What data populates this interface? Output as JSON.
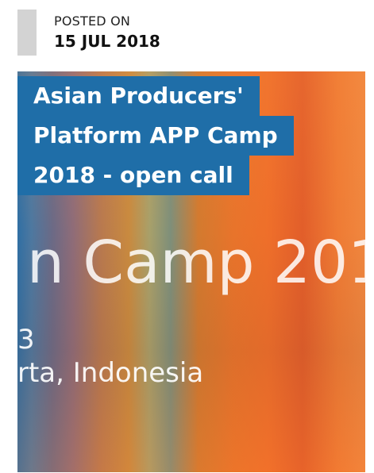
{
  "post_meta": {
    "label": "POSTED ON",
    "date": "15 JUL 2018"
  },
  "hero": {
    "title_lines": [
      "Asian Producers'",
      "Platform APP Camp",
      "2018 - open call"
    ],
    "image_text": {
      "line1": "n Camp 201",
      "line2": "3",
      "line3": "rta, Indonesia"
    }
  },
  "colors": {
    "title_bg": "#1f6ea8",
    "meta_bar": "#d3d3d3",
    "accent_orange": "#e8742b"
  }
}
